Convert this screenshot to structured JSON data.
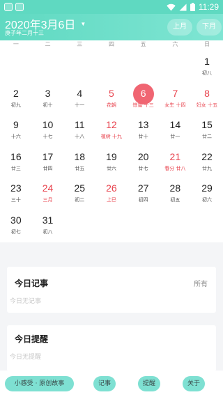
{
  "status_bar": {
    "time": "11:29"
  },
  "header": {
    "date_title": "2020年3月6日",
    "lunar_year": "庚子年二月十三",
    "prev_month": "上月",
    "next_month": "下月"
  },
  "weekdays": [
    "一",
    "二",
    "三",
    "四",
    "五",
    "六",
    "日"
  ],
  "days": [
    {
      "n": "1",
      "s": "初八",
      "red": false
    },
    {
      "n": "2",
      "s": "初九",
      "red": false
    },
    {
      "n": "3",
      "s": "初十",
      "red": false
    },
    {
      "n": "4",
      "s": "十一",
      "red": false
    },
    {
      "n": "5",
      "s": "花朝",
      "red": true
    },
    {
      "n": "6",
      "s": "惊蛰 十三",
      "red": true,
      "today": true
    },
    {
      "n": "7",
      "s": "女生 十四",
      "red": true
    },
    {
      "n": "8",
      "s": "妇女 十五",
      "red": true
    },
    {
      "n": "9",
      "s": "十六",
      "red": false
    },
    {
      "n": "10",
      "s": "十七",
      "red": false
    },
    {
      "n": "11",
      "s": "十八",
      "red": false
    },
    {
      "n": "12",
      "s": "植树 十九",
      "red": true
    },
    {
      "n": "13",
      "s": "廿十",
      "red": false
    },
    {
      "n": "14",
      "s": "廿一",
      "red": false
    },
    {
      "n": "15",
      "s": "廿二",
      "red": false
    },
    {
      "n": "16",
      "s": "廿三",
      "red": false
    },
    {
      "n": "17",
      "s": "廿四",
      "red": false
    },
    {
      "n": "18",
      "s": "廿五",
      "red": false
    },
    {
      "n": "19",
      "s": "廿六",
      "red": false
    },
    {
      "n": "20",
      "s": "廿七",
      "red": false
    },
    {
      "n": "21",
      "s": "春分 廿八",
      "red": true
    },
    {
      "n": "22",
      "s": "廿九",
      "red": false
    },
    {
      "n": "23",
      "s": "三十",
      "red": false
    },
    {
      "n": "24",
      "s": "三月",
      "red": true
    },
    {
      "n": "25",
      "s": "初二",
      "red": false
    },
    {
      "n": "26",
      "s": "上巳",
      "red": true
    },
    {
      "n": "27",
      "s": "初四",
      "red": false
    },
    {
      "n": "28",
      "s": "初五",
      "red": false
    },
    {
      "n": "29",
      "s": "初六",
      "red": false
    },
    {
      "n": "30",
      "s": "初七",
      "red": false
    },
    {
      "n": "31",
      "s": "初八",
      "red": false
    }
  ],
  "notes_card": {
    "title": "今日记事",
    "link": "所有",
    "empty": "今日无记事"
  },
  "reminder_card": {
    "title": "今日提醒",
    "empty": "今日无提醒"
  },
  "bottom_bar": {
    "story": "小感受 · 原创故事",
    "notes": "记事",
    "remind": "提醒",
    "about": "关于"
  },
  "colors": {
    "accent": "#5fd9c1",
    "holiday_red": "#e8434e",
    "today_circle": "#f06572",
    "pill": "#7ee0d2"
  }
}
